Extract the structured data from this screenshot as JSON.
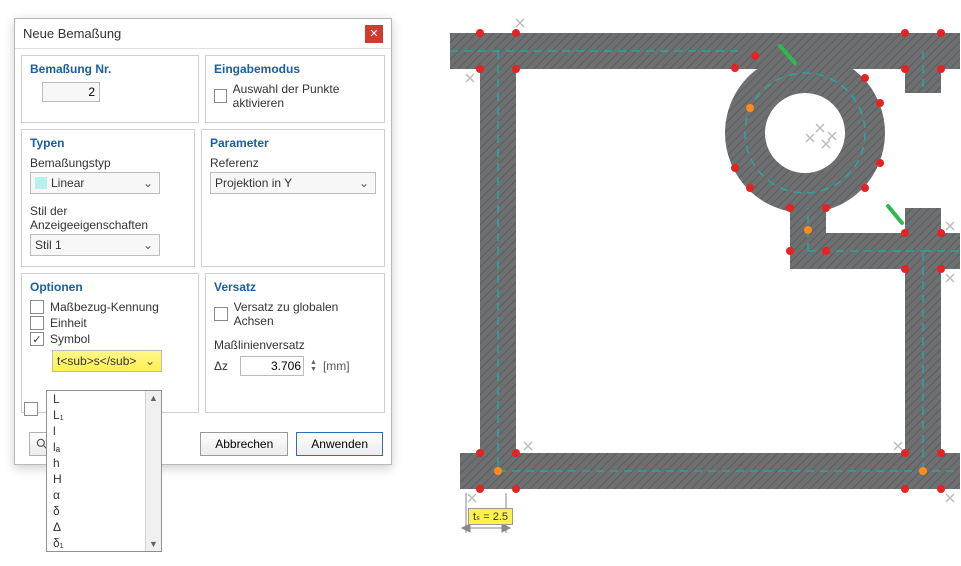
{
  "dialog": {
    "title": "Neue Bemaßung",
    "groups": {
      "nr": {
        "title": "Bemaßung Nr.",
        "value": "2"
      },
      "input_mode": {
        "title": "Eingabemodus",
        "checkbox_label": "Auswahl der Punkte aktivieren",
        "checked": false
      },
      "typen": {
        "title": "Typen",
        "type_label": "Bemaßungstyp",
        "type_value": "Linear",
        "style_label": "Stil der Anzeigeeigenschaften",
        "style_value": "Stil 1"
      },
      "parameter": {
        "title": "Parameter",
        "ref_label": "Referenz",
        "ref_value": "Projektion in Y"
      },
      "optionen": {
        "title": "Optionen",
        "cb1": "Maßbezug-Kennung",
        "cb2": "Einheit",
        "cb3": "Symbol",
        "symbol_value": "t<sub>s</sub>",
        "dropdown_items": [
          "L",
          "L₁",
          "l",
          "lₐ",
          "h",
          "H",
          "α",
          "δ",
          "Δ",
          "δ₁"
        ]
      },
      "versatz": {
        "title": "Versatz",
        "cb": "Versatz zu globalen Achsen",
        "offset_label": "Maßlinienversatz",
        "dz": "Δz",
        "dz_value": "3.706",
        "unit": "[mm]"
      }
    },
    "buttons": {
      "cancel": "Abbrechen",
      "apply": "Anwenden"
    }
  },
  "cad": {
    "dimension_label": "tₛ = 2.5"
  }
}
